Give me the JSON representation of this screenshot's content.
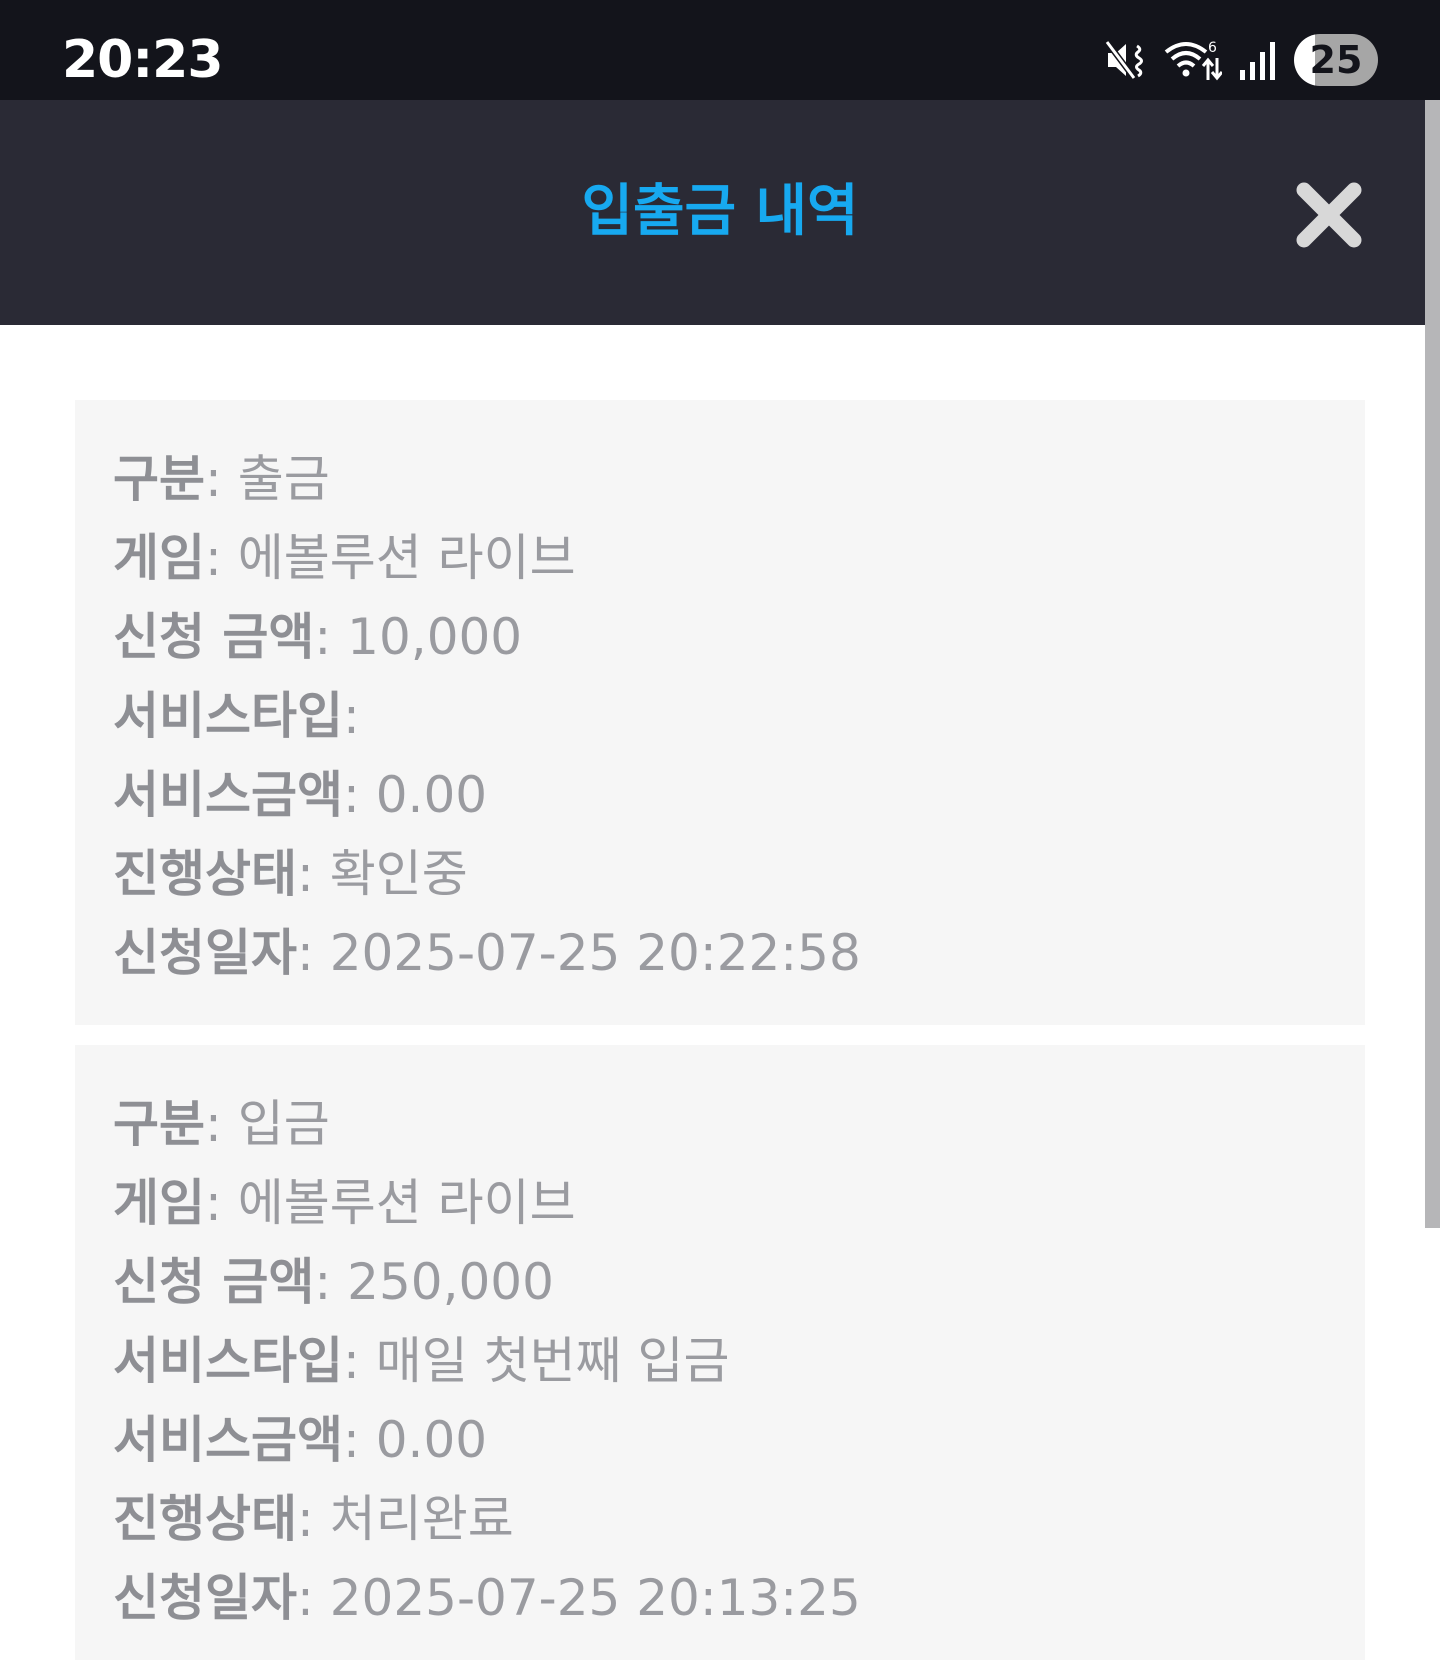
{
  "status_bar": {
    "time": "20:23",
    "battery": "25",
    "icons": [
      "mute-vibrate-icon",
      "wifi-icon",
      "signal-icon",
      "battery-icon"
    ]
  },
  "header": {
    "title": "입출금 내역",
    "close_icon": "close-icon",
    "title_color": "#17a9f0",
    "background": "#2a2a35"
  },
  "records": [
    {
      "fields": [
        {
          "label": "구분",
          "value": "출금"
        },
        {
          "label": "게임",
          "value": "에볼루션 라이브"
        },
        {
          "label": "신청 금액",
          "value": "10,000"
        },
        {
          "label": "서비스타입",
          "value": ""
        },
        {
          "label": "서비스금액",
          "value": "0.00"
        },
        {
          "label": "진행상태",
          "value": "확인중"
        },
        {
          "label": "신청일자",
          "value": "2025-07-25 20:22:58"
        }
      ]
    },
    {
      "fields": [
        {
          "label": "구분",
          "value": "입금"
        },
        {
          "label": "게임",
          "value": "에볼루션 라이브"
        },
        {
          "label": "신청 금액",
          "value": "250,000"
        },
        {
          "label": "서비스타입",
          "value": "매일 첫번째 입금"
        },
        {
          "label": "서비스금액",
          "value": "0.00"
        },
        {
          "label": "진행상태",
          "value": "처리완료"
        },
        {
          "label": "신청일자",
          "value": "2025-07-25 20:13:25"
        }
      ]
    }
  ]
}
